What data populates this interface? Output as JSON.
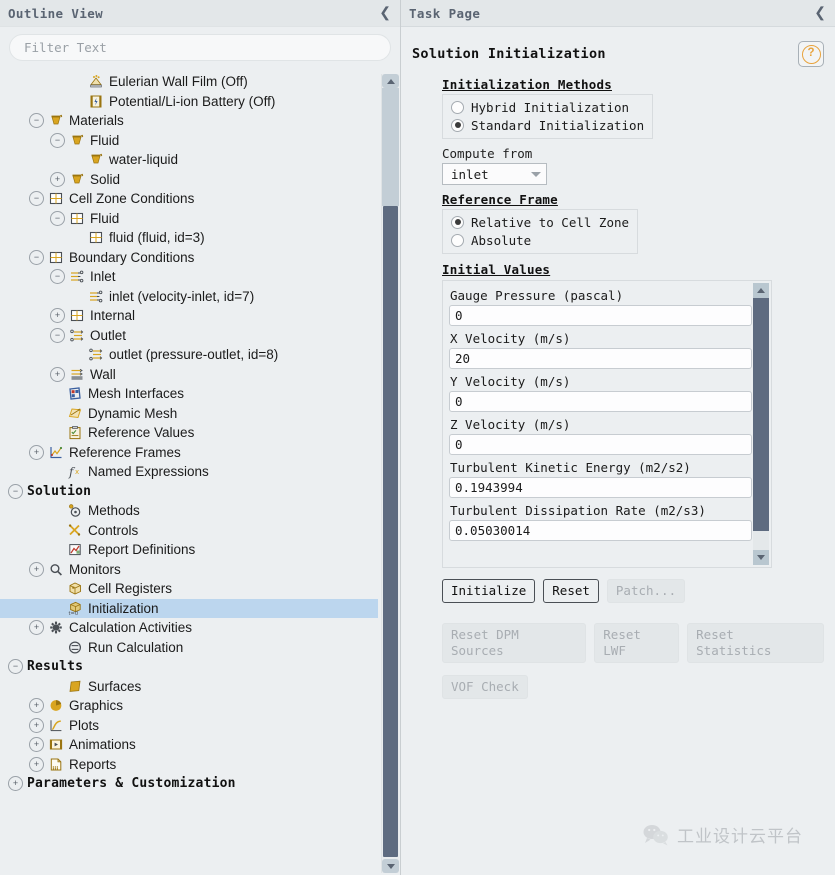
{
  "outline": {
    "header_title": "Outline View",
    "collapse_icon": "chevron-left-icon",
    "filter": {
      "value": "",
      "placeholder": "Filter Text"
    },
    "tree": [
      {
        "indent": 2,
        "toggle": "none",
        "icon": "eulerian-wall-film-icon",
        "label": "Eulerian Wall Film (Off)",
        "bold": false,
        "selected": false
      },
      {
        "indent": 2,
        "toggle": "none",
        "icon": "battery-icon",
        "label": "Potential/Li-ion Battery (Off)",
        "bold": false,
        "selected": false
      },
      {
        "indent": 0,
        "toggle": "minus",
        "icon": "material-icon",
        "label": "Materials",
        "bold": false,
        "selected": false
      },
      {
        "indent": 1,
        "toggle": "minus",
        "icon": "material-icon",
        "label": "Fluid",
        "bold": false,
        "selected": false
      },
      {
        "indent": 2,
        "toggle": "none",
        "icon": "material-icon",
        "label": "water-liquid",
        "bold": false,
        "selected": false
      },
      {
        "indent": 1,
        "toggle": "plus",
        "icon": "material-icon",
        "label": "Solid",
        "bold": false,
        "selected": false
      },
      {
        "indent": 0,
        "toggle": "minus",
        "icon": "cellzone-icon",
        "label": "Cell Zone Conditions",
        "bold": false,
        "selected": false
      },
      {
        "indent": 1,
        "toggle": "minus",
        "icon": "cellzone-icon",
        "label": "Fluid",
        "bold": false,
        "selected": false
      },
      {
        "indent": 2,
        "toggle": "none",
        "icon": "cellzone-icon",
        "label": "fluid (fluid, id=3)",
        "bold": false,
        "selected": false
      },
      {
        "indent": 0,
        "toggle": "minus",
        "icon": "cellzone-icon",
        "label": "Boundary Conditions",
        "bold": false,
        "selected": false
      },
      {
        "indent": 1,
        "toggle": "minus",
        "icon": "inlet-icon",
        "label": "Inlet",
        "bold": false,
        "selected": false
      },
      {
        "indent": 2,
        "toggle": "none",
        "icon": "inlet-icon",
        "label": "inlet (velocity-inlet, id=7)",
        "bold": false,
        "selected": false
      },
      {
        "indent": 1,
        "toggle": "plus",
        "icon": "cellzone-icon",
        "label": "Internal",
        "bold": false,
        "selected": false
      },
      {
        "indent": 1,
        "toggle": "minus",
        "icon": "outlet-icon",
        "label": "Outlet",
        "bold": false,
        "selected": false
      },
      {
        "indent": 2,
        "toggle": "none",
        "icon": "outlet-icon",
        "label": "outlet (pressure-outlet, id=8)",
        "bold": false,
        "selected": false
      },
      {
        "indent": 1,
        "toggle": "plus",
        "icon": "wall-icon",
        "label": "Wall",
        "bold": false,
        "selected": false
      },
      {
        "indent": 1,
        "toggle": "none",
        "icon": "mesh-interfaces-icon",
        "label": "Mesh Interfaces",
        "bold": false,
        "selected": false
      },
      {
        "indent": 1,
        "toggle": "none",
        "icon": "dynamic-mesh-icon",
        "label": "Dynamic Mesh",
        "bold": false,
        "selected": false
      },
      {
        "indent": 1,
        "toggle": "none",
        "icon": "reference-values-icon",
        "label": "Reference Values",
        "bold": false,
        "selected": false
      },
      {
        "indent": 0,
        "toggle": "plus",
        "icon": "reference-frames-icon",
        "label": "Reference Frames",
        "bold": false,
        "selected": false
      },
      {
        "indent": 1,
        "toggle": "none",
        "icon": "named-expressions-icon",
        "label": "Named Expressions",
        "bold": false,
        "selected": false
      },
      {
        "indent": -1,
        "toggle": "minus",
        "icon": "none",
        "label": "Solution",
        "bold": true,
        "selected": false
      },
      {
        "indent": 1,
        "toggle": "none",
        "icon": "methods-icon",
        "label": "Methods",
        "bold": false,
        "selected": false
      },
      {
        "indent": 1,
        "toggle": "none",
        "icon": "controls-icon",
        "label": "Controls",
        "bold": false,
        "selected": false
      },
      {
        "indent": 1,
        "toggle": "none",
        "icon": "report-definitions-icon",
        "label": "Report Definitions",
        "bold": false,
        "selected": false
      },
      {
        "indent": 0,
        "toggle": "plus",
        "icon": "monitors-icon",
        "label": "Monitors",
        "bold": false,
        "selected": false
      },
      {
        "indent": 1,
        "toggle": "none",
        "icon": "cell-registers-icon",
        "label": "Cell Registers",
        "bold": false,
        "selected": false
      },
      {
        "indent": 1,
        "toggle": "none",
        "icon": "initialization-icon",
        "label": "Initialization",
        "bold": false,
        "selected": true
      },
      {
        "indent": 0,
        "toggle": "plus",
        "icon": "calculation-activities-icon",
        "label": "Calculation Activities",
        "bold": false,
        "selected": false
      },
      {
        "indent": 1,
        "toggle": "none",
        "icon": "run-calculation-icon",
        "label": "Run Calculation",
        "bold": false,
        "selected": false
      },
      {
        "indent": -1,
        "toggle": "minus",
        "icon": "none",
        "label": "Results",
        "bold": true,
        "selected": false
      },
      {
        "indent": 1,
        "toggle": "none",
        "icon": "surfaces-icon",
        "label": "Surfaces",
        "bold": false,
        "selected": false
      },
      {
        "indent": 0,
        "toggle": "plus",
        "icon": "graphics-icon",
        "label": "Graphics",
        "bold": false,
        "selected": false
      },
      {
        "indent": 0,
        "toggle": "plus",
        "icon": "plots-icon",
        "label": "Plots",
        "bold": false,
        "selected": false
      },
      {
        "indent": 0,
        "toggle": "plus",
        "icon": "animations-icon",
        "label": "Animations",
        "bold": false,
        "selected": false
      },
      {
        "indent": 0,
        "toggle": "plus",
        "icon": "reports-icon",
        "label": "Reports",
        "bold": false,
        "selected": false
      },
      {
        "indent": -1,
        "toggle": "plus",
        "icon": "none",
        "label": "Parameters & Customization",
        "bold": true,
        "selected": false
      }
    ]
  },
  "task": {
    "header_title": "Task Page",
    "collapse_icon": "chevron-left-icon",
    "title": "Solution Initialization",
    "help_icon": "question-mark-icon",
    "init_methods": {
      "group_label": "Initialization Methods",
      "options": [
        {
          "label": "Hybrid  Initialization",
          "selected": false
        },
        {
          "label": "Standard Initialization",
          "selected": true
        }
      ]
    },
    "compute_from": {
      "label": "Compute from",
      "value": "inlet",
      "caret_icon": "chevron-down-icon"
    },
    "reference_frame": {
      "group_label": "Reference Frame",
      "options": [
        {
          "label": "Relative to Cell Zone",
          "selected": true
        },
        {
          "label": "Absolute",
          "selected": false
        }
      ]
    },
    "initial_values": {
      "group_label": "Initial Values",
      "fields": [
        {
          "label": "Gauge Pressure (pascal)",
          "value": "0"
        },
        {
          "label": "X Velocity (m/s)",
          "value": "20"
        },
        {
          "label": "Y Velocity (m/s)",
          "value": "0"
        },
        {
          "label": "Z Velocity (m/s)",
          "value": "0"
        },
        {
          "label": "Turbulent Kinetic Energy (m2/s2)",
          "value": "0.1943994"
        },
        {
          "label": "Turbulent Dissipation Rate (m2/s3)",
          "value": "0.05030014"
        }
      ]
    },
    "buttons_row1": [
      {
        "label": "Initialize",
        "state": "primary"
      },
      {
        "label": "Reset",
        "state": "normal"
      },
      {
        "label": "Patch...",
        "state": "disabled"
      }
    ],
    "buttons_row2": [
      {
        "label": "Reset DPM Sources",
        "state": "disabled"
      },
      {
        "label": "Reset LWF",
        "state": "disabled"
      },
      {
        "label": "Reset Statistics",
        "state": "disabled"
      }
    ],
    "buttons_row3": [
      {
        "label": "VOF Check",
        "state": "disabled"
      }
    ]
  },
  "watermark": {
    "icon": "wechat-icon",
    "text": "工业设计云平台"
  },
  "colors": {
    "panel_bg": "#eceff1",
    "header_bg": "#e3e7e9",
    "header_text": "#5a6472",
    "selection": "#bcd6ee",
    "scroll_thumb": "#5e6b80",
    "accent_orange": "#e8a33d",
    "icon_gold": "#d9a520"
  }
}
